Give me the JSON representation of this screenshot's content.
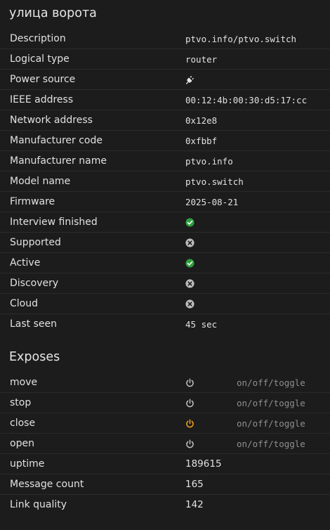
{
  "header": {
    "title": "улица ворота"
  },
  "info": {
    "description": {
      "label": "Description",
      "value": "ptvo.info/ptvo.switch"
    },
    "logical_type": {
      "label": "Logical type",
      "value": "router"
    },
    "power_source": {
      "label": "Power source",
      "icon": "plug-icon"
    },
    "ieee_address": {
      "label": "IEEE address",
      "value": "00:12:4b:00:30:d5:17:cc"
    },
    "network_address": {
      "label": "Network address",
      "value": "0x12e8"
    },
    "manufacturer_code": {
      "label": "Manufacturer code",
      "value": "0xfbbf"
    },
    "manufacturer_name": {
      "label": "Manufacturer name",
      "value": "ptvo.info"
    },
    "model_name": {
      "label": "Model name",
      "value": "ptvo.switch"
    },
    "firmware": {
      "label": "Firmware",
      "value": "2025-08-21"
    },
    "interview_finished": {
      "label": "Interview finished",
      "icon": "check-circle-icon",
      "state": true
    },
    "supported": {
      "label": "Supported",
      "icon": "x-circle-icon",
      "state": false
    },
    "active": {
      "label": "Active",
      "icon": "check-circle-icon",
      "state": true
    },
    "discovery": {
      "label": "Discovery",
      "icon": "x-circle-icon",
      "state": false
    },
    "cloud": {
      "label": "Cloud",
      "icon": "x-circle-icon",
      "state": false
    },
    "last_seen": {
      "label": "Last seen",
      "value": "45 sec"
    }
  },
  "exposes": {
    "title": "Exposes",
    "move": {
      "label": "move",
      "hint": "on/off/toggle",
      "on": false
    },
    "stop": {
      "label": "stop",
      "hint": "on/off/toggle",
      "on": false
    },
    "close": {
      "label": "close",
      "hint": "on/off/toggle",
      "on": true
    },
    "open": {
      "label": "open",
      "hint": "on/off/toggle",
      "on": false
    },
    "uptime": {
      "label": "uptime",
      "value": "189615"
    },
    "message_count": {
      "label": "Message count",
      "value": "165"
    },
    "link_quality": {
      "label": "Link quality",
      "value": "142"
    }
  },
  "colors": {
    "background": "#1c1c1c",
    "text": "#e1e1e1",
    "muted": "#8f8f8f",
    "divider": "#2b2b2b",
    "success": "#2e9e3e",
    "neutral_icon": "#bdbdbd",
    "power_on": "#f0a020"
  }
}
